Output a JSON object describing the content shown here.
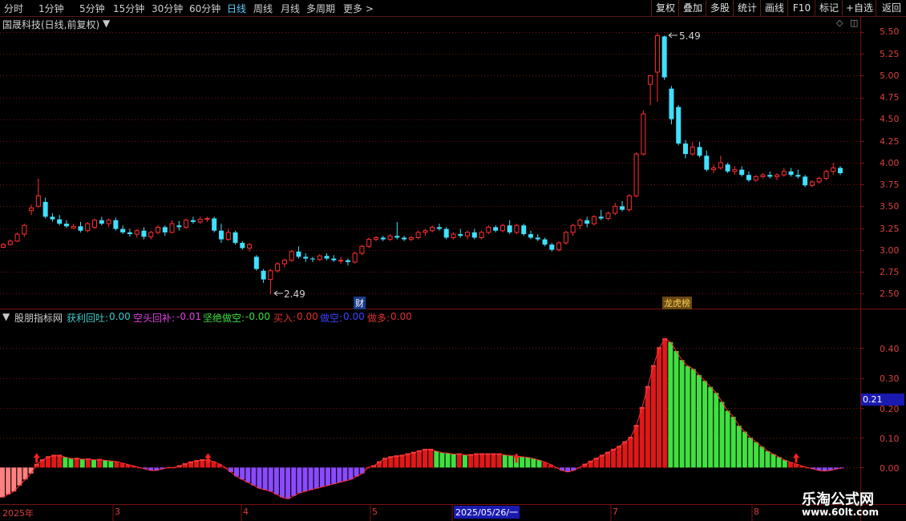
{
  "toolbar": {
    "left": [
      "分时",
      "1分钟",
      "5分钟",
      "15分钟",
      "30分钟",
      "60分钟",
      "日线",
      "周线",
      "月线",
      "多周期",
      "更多 >"
    ],
    "active": "日线",
    "right": [
      "复权",
      "叠加",
      "多股",
      "统计",
      "画线",
      "F10",
      "标记",
      "+自选",
      "返回"
    ]
  },
  "main_panel": {
    "title": "国晟科技(日线,前复权)",
    "high_label": "5.49",
    "low_label": "2.49",
    "marker_cai": "财",
    "marker_lhb": "龙虎榜",
    "y_ticks": [
      "5.50",
      "5.25",
      "5.00",
      "4.75",
      "4.50",
      "4.25",
      "4.00",
      "3.75",
      "3.50",
      "3.25",
      "3.00",
      "2.75",
      "2.50"
    ]
  },
  "indicator_panel": {
    "name": "股朋指标网",
    "items": [
      {
        "label": "获利回吐:",
        "value": "0.00",
        "color": "#40c8c8"
      },
      {
        "label": "空头回补:",
        "value": "-0.01",
        "color": "#e040e0"
      },
      {
        "label": "坚绝做空:",
        "value": "-0.00",
        "color": "#40e040"
      },
      {
        "label": "买入:",
        "value": "0.00",
        "color": "#e03030"
      },
      {
        "label": "做空:",
        "value": "0.00",
        "color": "#4040ff"
      },
      {
        "label": "做多:",
        "value": "0.00",
        "color": "#e03030"
      }
    ],
    "y_ticks": [
      "0.40",
      "0.30",
      "0.20",
      "0.10",
      "0.00"
    ],
    "current_value": "0.21"
  },
  "date_axis": {
    "labels": [
      "2025年",
      "3",
      "4",
      "5",
      "2025/05/26/一",
      "7",
      "8"
    ]
  },
  "watermark": {
    "title": "乐淘公式网",
    "url": "www.60lt.com"
  },
  "colors": {
    "up": "#ff3030",
    "down": "#40e0ff",
    "grid": "#7a1010",
    "axis_text": "#d84040"
  },
  "chart_data": {
    "type": "candlestick",
    "price_range": [
      2.4,
      5.6
    ],
    "candles": [
      {
        "o": 3.03,
        "h": 3.08,
        "l": 3.02,
        "c": 3.06
      },
      {
        "o": 3.06,
        "h": 3.12,
        "l": 3.05,
        "c": 3.1
      },
      {
        "o": 3.1,
        "h": 3.2,
        "l": 3.09,
        "c": 3.18
      },
      {
        "o": 3.18,
        "h": 3.3,
        "l": 3.15,
        "c": 3.28
      },
      {
        "o": 3.45,
        "h": 3.52,
        "l": 3.4,
        "c": 3.48
      },
      {
        "o": 3.5,
        "h": 3.82,
        "l": 3.48,
        "c": 3.62
      },
      {
        "o": 3.55,
        "h": 3.6,
        "l": 3.36,
        "c": 3.38
      },
      {
        "o": 3.38,
        "h": 3.42,
        "l": 3.32,
        "c": 3.35
      },
      {
        "o": 3.35,
        "h": 3.4,
        "l": 3.28,
        "c": 3.3
      },
      {
        "o": 3.3,
        "h": 3.34,
        "l": 3.25,
        "c": 3.27
      },
      {
        "o": 3.25,
        "h": 3.3,
        "l": 3.24,
        "c": 3.27
      },
      {
        "o": 3.27,
        "h": 3.32,
        "l": 3.2,
        "c": 3.22
      },
      {
        "o": 3.22,
        "h": 3.32,
        "l": 3.2,
        "c": 3.3
      },
      {
        "o": 3.26,
        "h": 3.36,
        "l": 3.24,
        "c": 3.34
      },
      {
        "o": 3.34,
        "h": 3.38,
        "l": 3.28,
        "c": 3.3
      },
      {
        "o": 3.3,
        "h": 3.36,
        "l": 3.26,
        "c": 3.34
      },
      {
        "o": 3.34,
        "h": 3.37,
        "l": 3.22,
        "c": 3.24
      },
      {
        "o": 3.24,
        "h": 3.28,
        "l": 3.18,
        "c": 3.2
      },
      {
        "o": 3.2,
        "h": 3.24,
        "l": 3.15,
        "c": 3.18
      },
      {
        "o": 3.18,
        "h": 3.24,
        "l": 3.14,
        "c": 3.22
      },
      {
        "o": 3.22,
        "h": 3.26,
        "l": 3.12,
        "c": 3.15
      },
      {
        "o": 3.15,
        "h": 3.22,
        "l": 3.12,
        "c": 3.2
      },
      {
        "o": 3.2,
        "h": 3.28,
        "l": 3.18,
        "c": 3.26
      },
      {
        "o": 3.26,
        "h": 3.28,
        "l": 3.16,
        "c": 3.2
      },
      {
        "o": 3.2,
        "h": 3.34,
        "l": 3.19,
        "c": 3.3
      },
      {
        "o": 3.28,
        "h": 3.33,
        "l": 3.22,
        "c": 3.26
      },
      {
        "o": 3.26,
        "h": 3.36,
        "l": 3.24,
        "c": 3.34
      },
      {
        "o": 3.34,
        "h": 3.38,
        "l": 3.3,
        "c": 3.32
      },
      {
        "o": 3.32,
        "h": 3.38,
        "l": 3.3,
        "c": 3.35
      },
      {
        "o": 3.35,
        "h": 3.38,
        "l": 3.32,
        "c": 3.36
      },
      {
        "o": 3.36,
        "h": 3.38,
        "l": 3.2,
        "c": 3.22
      },
      {
        "o": 3.22,
        "h": 3.3,
        "l": 3.08,
        "c": 3.12
      },
      {
        "o": 3.12,
        "h": 3.24,
        "l": 3.1,
        "c": 3.2
      },
      {
        "o": 3.2,
        "h": 3.22,
        "l": 3.06,
        "c": 3.08
      },
      {
        "o": 3.08,
        "h": 3.1,
        "l": 3.0,
        "c": 3.02
      },
      {
        "o": 3.02,
        "h": 3.08,
        "l": 2.98,
        "c": 3.06
      },
      {
        "o": 2.92,
        "h": 2.94,
        "l": 2.76,
        "c": 2.78
      },
      {
        "o": 2.76,
        "h": 2.78,
        "l": 2.62,
        "c": 2.66
      },
      {
        "o": 2.66,
        "h": 2.78,
        "l": 2.49,
        "c": 2.76
      },
      {
        "o": 2.76,
        "h": 2.86,
        "l": 2.74,
        "c": 2.84
      },
      {
        "o": 2.84,
        "h": 2.9,
        "l": 2.8,
        "c": 2.88
      },
      {
        "o": 2.88,
        "h": 3.0,
        "l": 2.86,
        "c": 2.98
      },
      {
        "o": 2.98,
        "h": 3.04,
        "l": 2.9,
        "c": 2.92
      },
      {
        "o": 2.92,
        "h": 2.96,
        "l": 2.86,
        "c": 2.9
      },
      {
        "o": 2.9,
        "h": 2.92,
        "l": 2.86,
        "c": 2.89
      },
      {
        "o": 2.89,
        "h": 2.95,
        "l": 2.87,
        "c": 2.93
      },
      {
        "o": 2.93,
        "h": 2.96,
        "l": 2.88,
        "c": 2.9
      },
      {
        "o": 2.9,
        "h": 2.94,
        "l": 2.86,
        "c": 2.88
      },
      {
        "o": 2.88,
        "h": 2.92,
        "l": 2.84,
        "c": 2.88
      },
      {
        "o": 2.88,
        "h": 2.9,
        "l": 2.82,
        "c": 2.86
      },
      {
        "o": 2.86,
        "h": 2.98,
        "l": 2.84,
        "c": 2.96
      },
      {
        "o": 2.96,
        "h": 3.06,
        "l": 2.94,
        "c": 3.04
      },
      {
        "o": 3.04,
        "h": 3.14,
        "l": 3.02,
        "c": 3.12
      },
      {
        "o": 3.12,
        "h": 3.16,
        "l": 3.1,
        "c": 3.14
      },
      {
        "o": 3.14,
        "h": 3.16,
        "l": 3.1,
        "c": 3.12
      },
      {
        "o": 3.12,
        "h": 3.18,
        "l": 3.1,
        "c": 3.16
      },
      {
        "o": 3.16,
        "h": 3.32,
        "l": 3.12,
        "c": 3.14
      },
      {
        "o": 3.14,
        "h": 3.16,
        "l": 3.1,
        "c": 3.12
      },
      {
        "o": 3.12,
        "h": 3.16,
        "l": 3.1,
        "c": 3.14
      },
      {
        "o": 3.14,
        "h": 3.22,
        "l": 3.12,
        "c": 3.2
      },
      {
        "o": 3.2,
        "h": 3.24,
        "l": 3.16,
        "c": 3.22
      },
      {
        "o": 3.22,
        "h": 3.28,
        "l": 3.2,
        "c": 3.26
      },
      {
        "o": 3.26,
        "h": 3.3,
        "l": 3.22,
        "c": 3.24
      },
      {
        "o": 3.24,
        "h": 3.26,
        "l": 3.12,
        "c": 3.14
      },
      {
        "o": 3.14,
        "h": 3.2,
        "l": 3.12,
        "c": 3.18
      },
      {
        "o": 3.18,
        "h": 3.24,
        "l": 3.14,
        "c": 3.16
      },
      {
        "o": 3.16,
        "h": 3.22,
        "l": 3.12,
        "c": 3.2
      },
      {
        "o": 3.2,
        "h": 3.24,
        "l": 3.12,
        "c": 3.14
      },
      {
        "o": 3.14,
        "h": 3.22,
        "l": 3.12,
        "c": 3.2
      },
      {
        "o": 3.2,
        "h": 3.28,
        "l": 3.18,
        "c": 3.26
      },
      {
        "o": 3.26,
        "h": 3.28,
        "l": 3.2,
        "c": 3.22
      },
      {
        "o": 3.22,
        "h": 3.3,
        "l": 3.2,
        "c": 3.28
      },
      {
        "o": 3.28,
        "h": 3.34,
        "l": 3.18,
        "c": 3.2
      },
      {
        "o": 3.2,
        "h": 3.3,
        "l": 3.18,
        "c": 3.28
      },
      {
        "o": 3.28,
        "h": 3.3,
        "l": 3.16,
        "c": 3.18
      },
      {
        "o": 3.18,
        "h": 3.22,
        "l": 3.12,
        "c": 3.14
      },
      {
        "o": 3.14,
        "h": 3.18,
        "l": 3.1,
        "c": 3.12
      },
      {
        "o": 3.12,
        "h": 3.14,
        "l": 3.04,
        "c": 3.06
      },
      {
        "o": 3.06,
        "h": 3.08,
        "l": 2.98,
        "c": 3.0
      },
      {
        "o": 3.0,
        "h": 3.1,
        "l": 2.98,
        "c": 3.08
      },
      {
        "o": 3.08,
        "h": 3.22,
        "l": 3.06,
        "c": 3.2
      },
      {
        "o": 3.2,
        "h": 3.3,
        "l": 3.16,
        "c": 3.28
      },
      {
        "o": 3.28,
        "h": 3.36,
        "l": 3.24,
        "c": 3.34
      },
      {
        "o": 3.34,
        "h": 3.38,
        "l": 3.26,
        "c": 3.3
      },
      {
        "o": 3.3,
        "h": 3.4,
        "l": 3.28,
        "c": 3.38
      },
      {
        "o": 3.38,
        "h": 3.46,
        "l": 3.34,
        "c": 3.36
      },
      {
        "o": 3.36,
        "h": 3.44,
        "l": 3.34,
        "c": 3.42
      },
      {
        "o": 3.42,
        "h": 3.54,
        "l": 3.4,
        "c": 3.5
      },
      {
        "o": 3.5,
        "h": 3.56,
        "l": 3.44,
        "c": 3.46
      },
      {
        "o": 3.46,
        "h": 3.64,
        "l": 3.44,
        "c": 3.62
      },
      {
        "o": 3.62,
        "h": 4.12,
        "l": 3.6,
        "c": 4.1
      },
      {
        "o": 4.1,
        "h": 4.6,
        "l": 4.08,
        "c": 4.56
      },
      {
        "o": 4.9,
        "h": 5.0,
        "l": 4.66,
        "c": 5.0
      },
      {
        "o": 5.04,
        "h": 5.49,
        "l": 4.7,
        "c": 5.46
      },
      {
        "o": 5.45,
        "h": 5.46,
        "l": 4.95,
        "c": 4.98
      },
      {
        "o": 4.85,
        "h": 4.88,
        "l": 4.44,
        "c": 4.5
      },
      {
        "o": 4.64,
        "h": 4.66,
        "l": 4.2,
        "c": 4.22
      },
      {
        "o": 4.22,
        "h": 4.26,
        "l": 4.05,
        "c": 4.1
      },
      {
        "o": 4.1,
        "h": 4.24,
        "l": 4.08,
        "c": 4.18
      },
      {
        "o": 4.18,
        "h": 4.24,
        "l": 4.06,
        "c": 4.08
      },
      {
        "o": 4.08,
        "h": 4.14,
        "l": 3.9,
        "c": 3.92
      },
      {
        "o": 3.92,
        "h": 3.98,
        "l": 3.88,
        "c": 3.94
      },
      {
        "o": 3.94,
        "h": 4.08,
        "l": 3.92,
        "c": 4.0
      },
      {
        "o": 3.98,
        "h": 4.0,
        "l": 3.88,
        "c": 3.9
      },
      {
        "o": 3.9,
        "h": 3.96,
        "l": 3.86,
        "c": 3.92
      },
      {
        "o": 3.92,
        "h": 3.96,
        "l": 3.84,
        "c": 3.86
      },
      {
        "o": 3.86,
        "h": 3.9,
        "l": 3.78,
        "c": 3.8
      },
      {
        "o": 3.8,
        "h": 3.86,
        "l": 3.78,
        "c": 3.84
      },
      {
        "o": 3.84,
        "h": 3.88,
        "l": 3.82,
        "c": 3.86
      },
      {
        "o": 3.86,
        "h": 3.9,
        "l": 3.82,
        "c": 3.84
      },
      {
        "o": 3.84,
        "h": 3.88,
        "l": 3.8,
        "c": 3.86
      },
      {
        "o": 3.86,
        "h": 3.94,
        "l": 3.84,
        "c": 3.9
      },
      {
        "o": 3.9,
        "h": 3.94,
        "l": 3.84,
        "c": 3.86
      },
      {
        "o": 3.86,
        "h": 3.92,
        "l": 3.82,
        "c": 3.84
      },
      {
        "o": 3.84,
        "h": 3.86,
        "l": 3.72,
        "c": 3.74
      },
      {
        "o": 3.74,
        "h": 3.8,
        "l": 3.72,
        "c": 3.78
      },
      {
        "o": 3.78,
        "h": 3.84,
        "l": 3.76,
        "c": 3.82
      },
      {
        "o": 3.82,
        "h": 3.92,
        "l": 3.8,
        "c": 3.9
      },
      {
        "o": 3.9,
        "h": 4.0,
        "l": 3.86,
        "c": 3.94
      },
      {
        "o": 3.94,
        "h": 3.96,
        "l": 3.86,
        "c": 3.88
      }
    ],
    "indicator_range": [
      -0.12,
      0.5
    ],
    "indicator_bars": [
      -0.1,
      -0.09,
      -0.08,
      -0.06,
      -0.04,
      -0.02,
      0.01,
      0.025,
      0.035,
      0.04,
      0.04,
      0.035,
      0.03,
      0.03,
      0.028,
      0.028,
      0.026,
      0.026,
      0.024,
      0.022,
      0.02,
      0.015,
      0.01,
      0.005,
      0.0,
      -0.005,
      -0.01,
      -0.01,
      -0.005,
      0.0,
      0.0,
      0.005,
      0.012,
      0.018,
      0.022,
      0.025,
      0.025,
      0.02,
      0.012,
      0.0,
      -0.015,
      -0.03,
      -0.04,
      -0.05,
      -0.06,
      -0.07,
      -0.075,
      -0.08,
      -0.09,
      -0.1,
      -0.105,
      -0.095,
      -0.085,
      -0.08,
      -0.075,
      -0.07,
      -0.065,
      -0.06,
      -0.055,
      -0.05,
      -0.045,
      -0.04,
      -0.03,
      -0.02,
      0.0,
      0.005,
      0.018,
      0.03,
      0.035,
      0.038,
      0.04,
      0.045,
      0.05,
      0.055,
      0.06,
      0.06,
      0.055,
      0.05,
      0.048,
      0.045,
      0.045,
      0.042,
      0.042,
      0.045,
      0.045,
      0.045,
      0.045,
      0.045,
      0.042,
      0.04,
      0.038,
      0.036,
      0.034,
      0.03,
      0.025,
      0.018,
      0.01,
      0.0,
      -0.01,
      -0.015,
      -0.01,
      0.0,
      0.01,
      0.02,
      0.03,
      0.04,
      0.05,
      0.06,
      0.07,
      0.085,
      0.1,
      0.14,
      0.2,
      0.27,
      0.34,
      0.4,
      0.43,
      0.42,
      0.39,
      0.36,
      0.34,
      0.33,
      0.31,
      0.29,
      0.27,
      0.25,
      0.22,
      0.19,
      0.17,
      0.14,
      0.12,
      0.1,
      0.085,
      0.07,
      0.055,
      0.045,
      0.035,
      0.025,
      0.018,
      0.012,
      0.005,
      0.0,
      -0.005,
      -0.01,
      -0.012,
      -0.01,
      -0.005,
      -0.002
    ],
    "buy_arrows": [
      6,
      36,
      90,
      139
    ]
  }
}
